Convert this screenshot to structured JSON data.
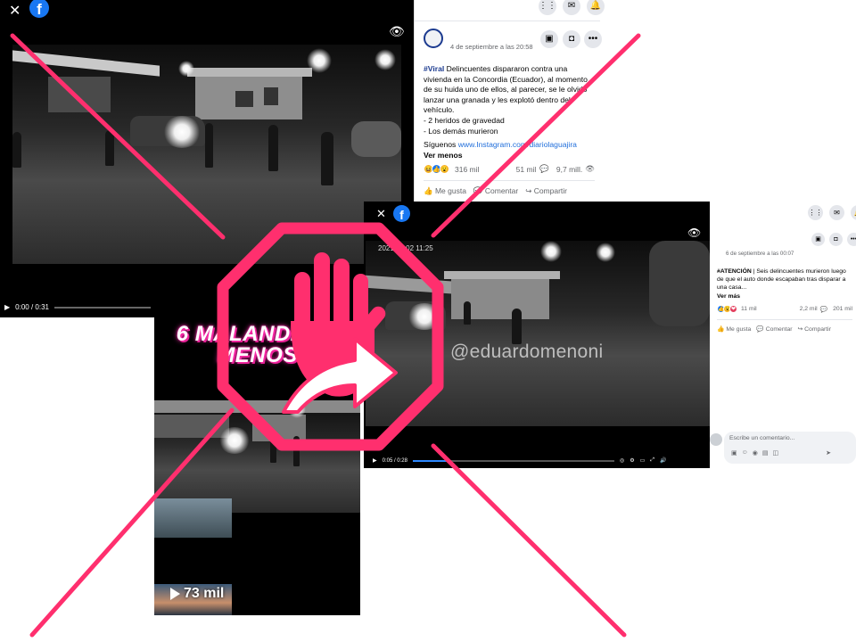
{
  "shot1": {
    "close_icon": "close-icon",
    "fb_logo": "f",
    "video_time": "0:00 / 0:31",
    "progress": 0.0,
    "post_date": "4 de septiembre a las 20:58",
    "post_tag": "#Viral",
    "post_body": " Delincuentes dispararon contra una vivienda en la Concordia (Ecuador), al momento de su huida uno de ellos, al parecer, se le olvidó lanzar una granada y les explotó dentro del vehículo.",
    "post_line1": "- 2 heridos de gravedad",
    "post_line2": "- Los demás murieron",
    "follow_label": "Síguenos ",
    "follow_link": "www.Instagram.com/diariolaguajira",
    "see_less": "Ver menos",
    "reactions_count": "316 mil",
    "comments_count": "51 mil",
    "views_count": "9,7 mill.",
    "like_label": "Me gusta",
    "comment_label": "Comentar",
    "share_label": "Compartir"
  },
  "shot2": {
    "fb_logo": "f",
    "video_time": "0:05 / 0:28",
    "progress": 0.18,
    "video_timestamp": "2021 09 02  11:25",
    "watermark": "@eduardomenoni",
    "post_date": "6 de septiembre a las 00:07",
    "post_tag": "#ATENCIÓN",
    "post_body": " | Seis delincuentes murieron luego de que el auto donde escapaban tras disparar a una casa...",
    "see_more": "Ver más",
    "reactions_count": "11 mil",
    "comments_count": "2,2 mil",
    "views_count": "201 mil",
    "like_label": "Me gusta",
    "comment_label": "Comentar",
    "share_label": "Compartir",
    "comment_placeholder": "Escribe un comentario..."
  },
  "shot3": {
    "title_line1": "6 MALANDROS",
    "title_line2": "MENOS",
    "views": "73 mil"
  },
  "colors": {
    "cross_pink": "#ff2f6e",
    "stop_pink": "#ff2f6e",
    "facebook_blue": "#1877f2",
    "title_pink": "#ff2fb0"
  },
  "icons": [
    "close-icon",
    "facebook-logo-icon",
    "eye-slash-icon",
    "play-icon",
    "grid-menu-icon",
    "messenger-icon",
    "notifications-icon",
    "more-icon",
    "settings-icon",
    "fullscreen-icon",
    "volume-icon",
    "stop-hand-icon",
    "arrow-icon"
  ]
}
